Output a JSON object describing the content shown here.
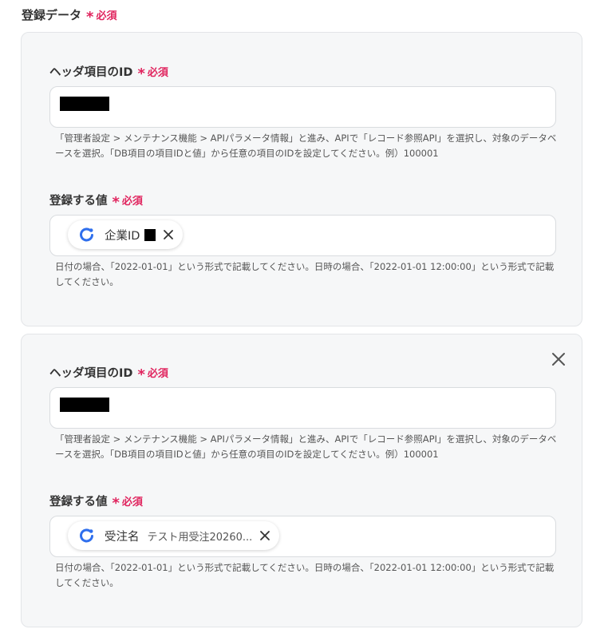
{
  "section": {
    "title": "登録データ",
    "required": "必須"
  },
  "blocks": [
    {
      "header_label": "ヘッダ項目のID",
      "required": "必須",
      "header_help": "「管理者設定 > メンテナンス機能 > APIパラメータ情報」と進み、APIで「レコード参照API」を選択し、対象のデータベースを選択。「DB項目の項目IDと値」から任意の項目のIDを設定してください。例）100001",
      "value_label": "登録する値",
      "value_chip": {
        "label": "企業ID",
        "value": ""
      },
      "value_help": "日付の場合、「2022-01-01」という形式で記載してください。日時の場合、「2022-01-01 12:00:00」という形式で記載してください。"
    },
    {
      "header_label": "ヘッダ項目のID",
      "required": "必須",
      "header_help": "「管理者設定 > メンテナンス機能 > APIパラメータ情報」と進み、APIで「レコード参照API」を選択し、対象のデータベースを選択。「DB項目の項目IDと値」から任意の項目のIDを設定してください。例）100001",
      "value_label": "登録する値",
      "value_chip": {
        "label": "受注名",
        "value": "テスト用受注20260..."
      },
      "value_help": "日付の場合、「2022-01-01」という形式で記載してください。日時の場合、「2022-01-01 12:00:00」という形式で記載してください。"
    }
  ],
  "icons": {
    "chip": "sync-link-icon",
    "remove": "close-icon"
  },
  "colors": {
    "required": "#e0245e",
    "chip_icon": "#2f6fed"
  }
}
